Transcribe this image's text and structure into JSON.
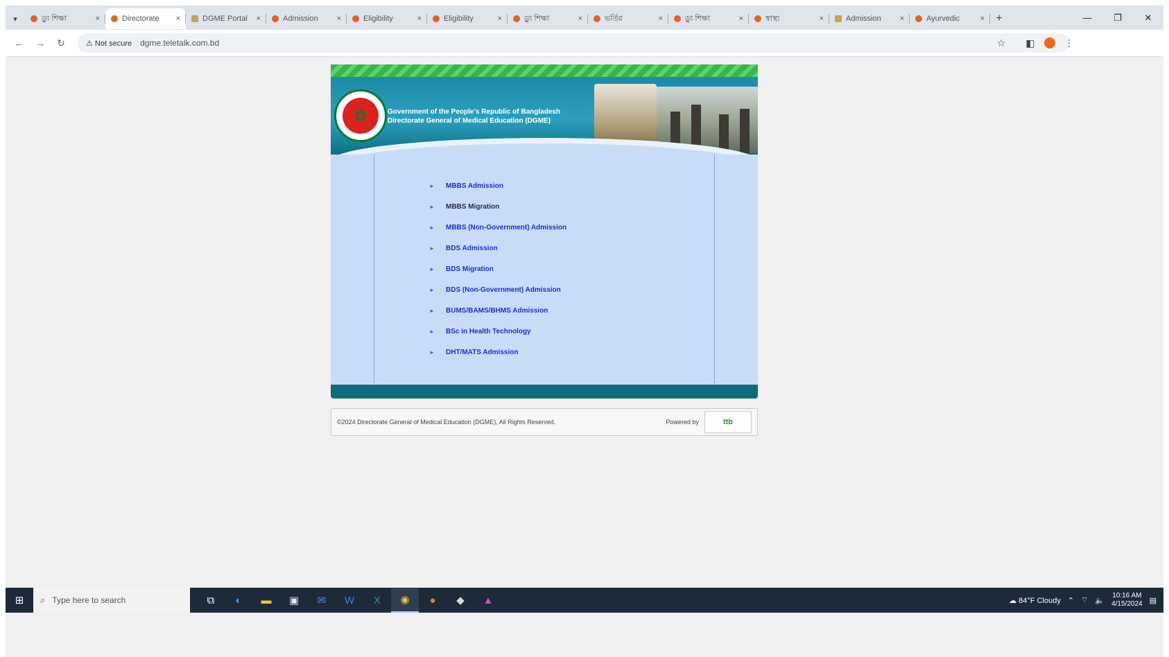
{
  "browser": {
    "tabs": [
      {
        "label": "ড়্যু শিক্ষা",
        "active": false
      },
      {
        "label": "Directorate",
        "active": true
      },
      {
        "label": "DGME Portal",
        "active": false
      },
      {
        "label": "Admission",
        "active": false
      },
      {
        "label": "Eligibility",
        "active": false
      },
      {
        "label": "Eligibility",
        "active": false
      },
      {
        "label": "ড়্যু শিক্ষা",
        "active": false
      },
      {
        "label": "ভর্তির",
        "active": false
      },
      {
        "label": "ড়্যু শিক্ষা",
        "active": false
      },
      {
        "label": "স্বাস্থ্য",
        "active": false
      },
      {
        "label": "Admission",
        "active": false
      },
      {
        "label": "Ayurvedic",
        "active": false
      }
    ],
    "security_label": "Not secure",
    "url": "dgme.teletalk.com.bd",
    "profile_initial": ""
  },
  "site": {
    "header_line1": "Government of the People's Republic of Bangladesh",
    "header_line2": "Directorate General of Medical Education (DGME)",
    "menu": [
      {
        "label": "MBBS Admission",
        "visited": false
      },
      {
        "label": "MBBS Migration",
        "visited": true
      },
      {
        "label": "MBBS (Non-Government) Admission",
        "visited": false
      },
      {
        "label": "BDS Admission",
        "visited": false
      },
      {
        "label": "BDS Migration",
        "visited": false
      },
      {
        "label": "BDS (Non-Government) Admission",
        "visited": false
      },
      {
        "label": "BUMS/BAMS/BHMS Admission",
        "visited": false
      },
      {
        "label": "BSc in Health Technology",
        "visited": false
      },
      {
        "label": "DHT/MATS Admission",
        "visited": false
      }
    ],
    "footer_copyright": "©2024 Directorate General of Medical Education (DGME), All Rights Reserved.",
    "footer_powered": "Powered by",
    "footer_logo_text": "ttb"
  },
  "taskbar": {
    "search_placeholder": "Type here to search",
    "weather": "84°F Cloudy",
    "time": "10:16 AM",
    "date": "4/15/2024"
  }
}
